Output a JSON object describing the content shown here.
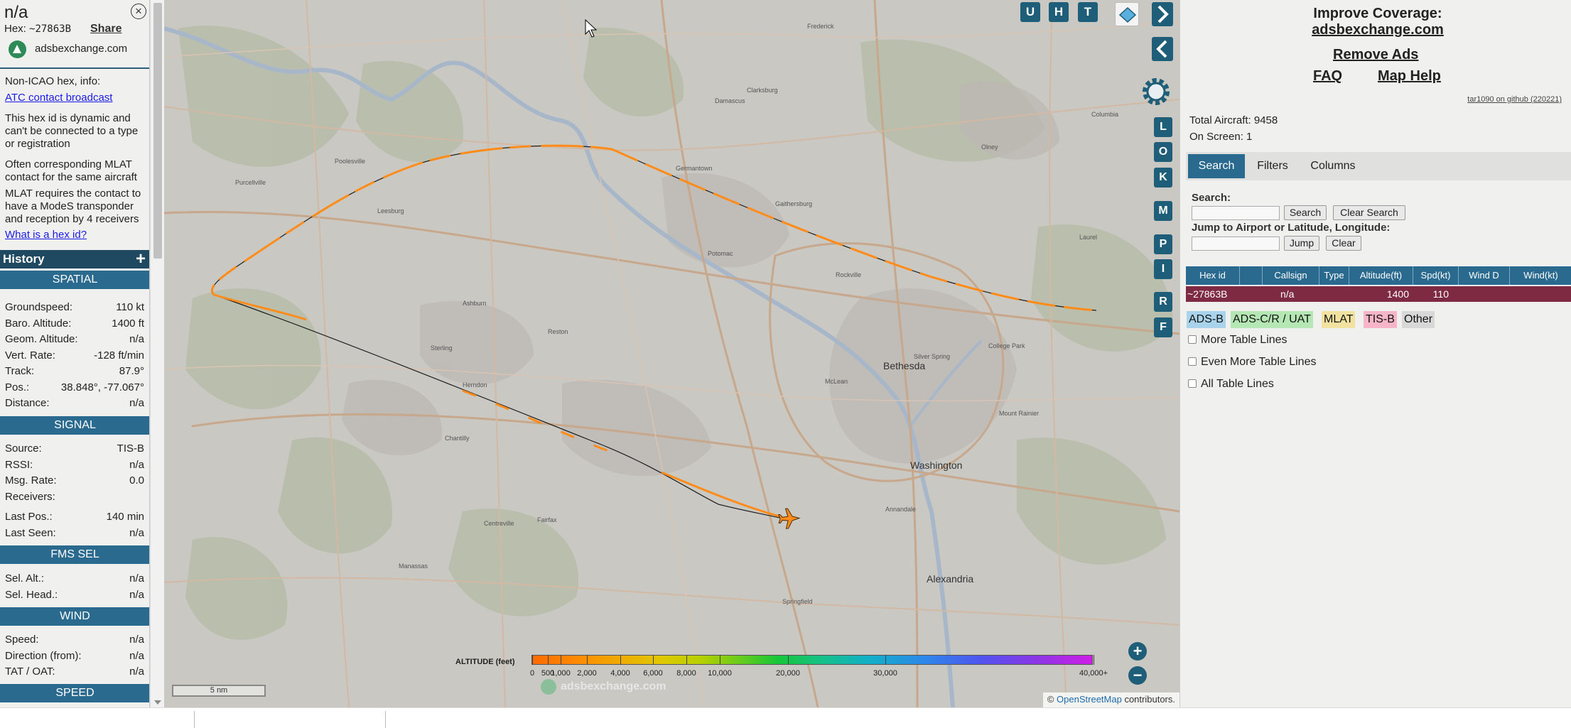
{
  "aircraft": {
    "title": "n/a",
    "hex_label": "Hex:",
    "hex_value": "~27863B",
    "share": "Share",
    "site": "adsbexchange.com",
    "note1": "Non-ICAO hex, info:",
    "note1_link": "ATC contact broadcast",
    "note2": "This hex id is dynamic and can't be connected to a type or registration",
    "note3": "Often corresponding MLAT contact for the same aircraft",
    "note4": "MLAT requires the contact to have a ModeS transponder and reception by 4 receivers",
    "note4_link": "What is a hex id?"
  },
  "history": {
    "label": "History",
    "plus": "+"
  },
  "spatial": {
    "header": "SPATIAL",
    "rows": [
      {
        "k": "Groundspeed:",
        "v": "110 kt"
      },
      {
        "k": "Baro. Altitude:",
        "v": "1400 ft"
      },
      {
        "k": "Geom. Altitude:",
        "v": "n/a"
      },
      {
        "k": "Vert. Rate:",
        "v": "-128 ft/min"
      },
      {
        "k": "Track:",
        "v": "87.9°"
      },
      {
        "k": "Pos.:",
        "v": "38.848°, -77.067°"
      },
      {
        "k": "Distance:",
        "v": "n/a"
      }
    ]
  },
  "signal": {
    "header": "SIGNAL",
    "rows": [
      {
        "k": "Source:",
        "v": "TIS-B"
      },
      {
        "k": "RSSI:",
        "v": "n/a"
      },
      {
        "k": "Msg. Rate:",
        "v": "0.0"
      },
      {
        "k": "Receivers:",
        "v": ""
      },
      {
        "k": "Last Pos.:",
        "v": "140 min"
      },
      {
        "k": "Last Seen:",
        "v": "n/a"
      }
    ]
  },
  "fms": {
    "header": "FMS SEL",
    "rows": [
      {
        "k": "Sel. Alt.:",
        "v": "n/a"
      },
      {
        "k": "Sel. Head.:",
        "v": "n/a"
      }
    ]
  },
  "wind": {
    "header": "WIND",
    "rows": [
      {
        "k": "Speed:",
        "v": "n/a"
      },
      {
        "k": "Direction (from):",
        "v": "n/a"
      },
      {
        "k": "TAT / OAT:",
        "v": "n/a"
      }
    ]
  },
  "speed": {
    "header": "SPEED"
  },
  "map": {
    "top_buttons": [
      "U",
      "H",
      "T"
    ],
    "side_buttons": [
      "L",
      "O",
      "K",
      "M",
      "P",
      "I",
      "R",
      "F"
    ],
    "altitude_title": "ALTITUDE (feet)",
    "altitude_ticks": [
      "0",
      "500",
      "1,000",
      "2,000",
      "4,000",
      "6,000",
      "8,000",
      "10,000",
      "20,000",
      "30,000",
      "40,000+"
    ],
    "watermark": "adsbexchange.com",
    "scale": "5 nm",
    "attribution_prefix": "©",
    "attribution_link": "OpenStreetMap",
    "attribution_suffix": "contributors.",
    "places": [
      {
        "name": "Washington"
      },
      {
        "name": "Bethesda"
      },
      {
        "name": "Alexandria"
      },
      {
        "name": "Silver Spring"
      },
      {
        "name": "Rockville"
      },
      {
        "name": "Gaithersburg"
      },
      {
        "name": "Germantown"
      },
      {
        "name": "Leesburg"
      },
      {
        "name": "Ashburn"
      },
      {
        "name": "Sterling"
      },
      {
        "name": "Herndon"
      },
      {
        "name": "Reston"
      },
      {
        "name": "Fairfax"
      },
      {
        "name": "Chantilly"
      },
      {
        "name": "Centreville"
      },
      {
        "name": "Manassas"
      },
      {
        "name": "Columbia"
      },
      {
        "name": "Laurel"
      },
      {
        "name": "Frederick"
      },
      {
        "name": "Poolesville"
      },
      {
        "name": "Purcellville"
      },
      {
        "name": "Annandale"
      },
      {
        "name": "Springfield"
      },
      {
        "name": "College Park"
      },
      {
        "name": "Mount Rainier"
      },
      {
        "name": "Olney"
      },
      {
        "name": "Damascus"
      },
      {
        "name": "Clarksburg"
      },
      {
        "name": "Potomac"
      },
      {
        "name": "McLean"
      }
    ]
  },
  "right": {
    "coverage_line1": "Improve Coverage:",
    "coverage_line2": "adsbexchange.com",
    "remove_ads": "Remove Ads",
    "faq": "FAQ",
    "map_help": "Map Help",
    "version": "tar1090 on github (220221)",
    "total_aircraft": "Total Aircraft: 9458",
    "on_screen": "On Screen: 1",
    "tabs": [
      "Search",
      "Filters",
      "Columns"
    ],
    "search_label": "Search:",
    "search_button": "Search",
    "clear_search_button": "Clear Search",
    "jump_label": "Jump to Airport or Latitude, Longitude:",
    "jump_button": "Jump",
    "clear_button": "Clear",
    "table_headers": [
      "Hex id",
      "",
      "Callsign",
      "Type",
      "Altitude(ft)",
      "Spd(kt)",
      "Wind D",
      "Wind(kt)"
    ],
    "table_row": [
      "~27863B",
      "",
      "n/a",
      "",
      "1400",
      "110",
      "",
      ""
    ],
    "source_tags": [
      {
        "label": "ADS-B",
        "color": "#a9d3ea"
      },
      {
        "label": "ADS-C/R / UAT",
        "color": "#b5e7b5"
      },
      {
        "label": "MLAT",
        "color": "#f2e2a0"
      },
      {
        "label": "TIS-B",
        "color": "#f7b6c8"
      },
      {
        "label": "Other",
        "color": "#d8d8d8"
      }
    ],
    "checkboxes": [
      "More Table Lines",
      "Even More Table Lines",
      "All Table Lines"
    ]
  },
  "colors": {
    "accent": "#2b6a8f",
    "track": "#ff8c1a",
    "row_highlight": "#7e2a42"
  }
}
